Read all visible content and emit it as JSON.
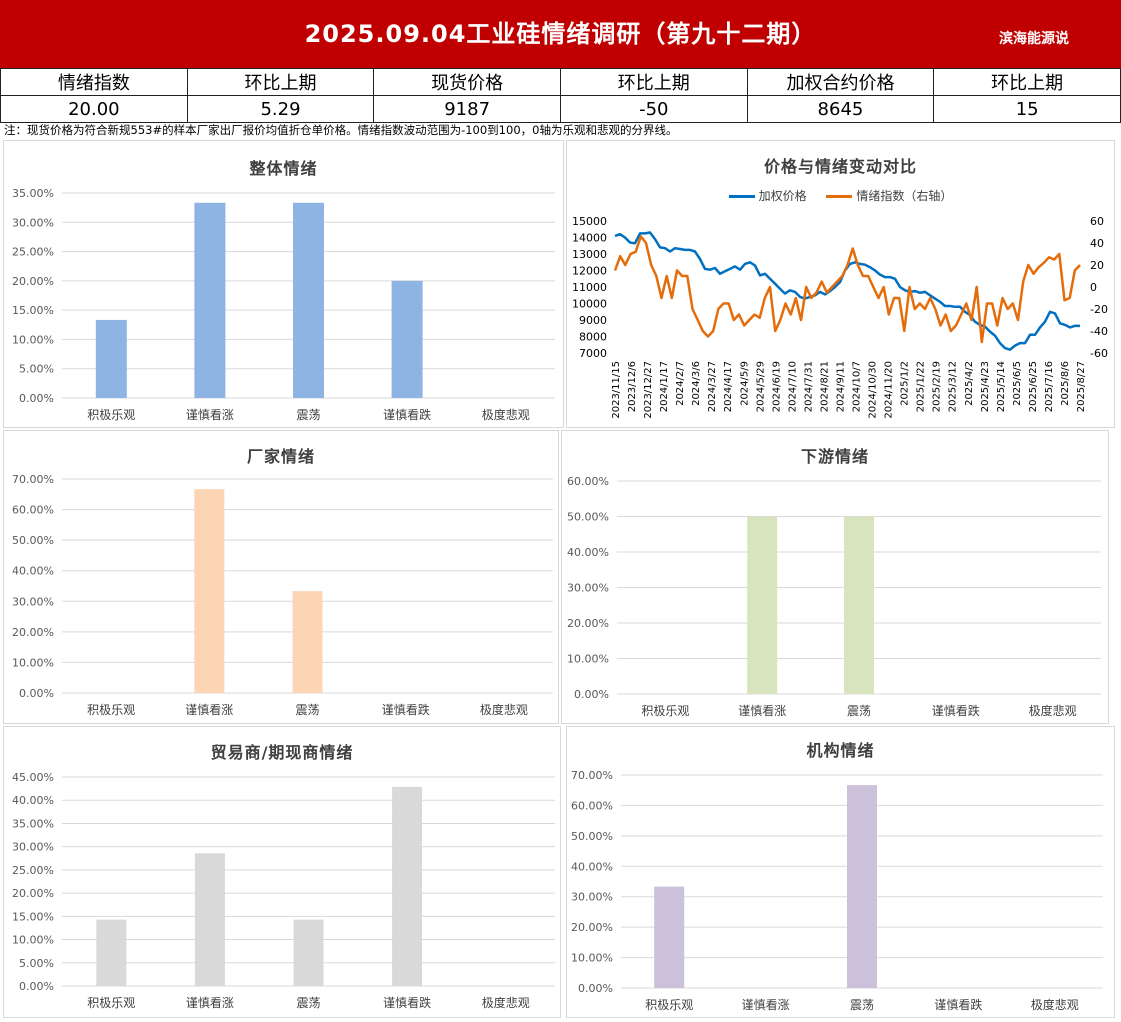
{
  "header": {
    "title": "2025.09.04工业硅情绪调研（第九十二期）",
    "brand": "滨海能源说"
  },
  "summary": {
    "labels": [
      "情绪指数",
      "环比上期",
      "现货价格",
      "环比上期",
      "加权合约价格",
      "环比上期"
    ],
    "values": [
      "20.00",
      "5.29",
      "9187",
      "-50",
      "8645",
      "15"
    ]
  },
  "note": "注：现货价格为符合新规553#的样本厂家出厂报价均值折仓单价格。情绪指数波动范围为-100到100，0轴为乐观和悲观的分界线。",
  "colors": {
    "header_bg": "#c00000",
    "overall": "#8eb4e3",
    "manufacturer": "#fcd5b5",
    "downstream": "#d7e4bd",
    "trader": "#d9d9d9",
    "institution": "#ccc1da",
    "price_line": "#0070c0",
    "sentiment_line": "#e46c0a"
  },
  "chart_data": [
    {
      "type": "bar",
      "title": "整体情绪",
      "categories": [
        "积极乐观",
        "谨慎看涨",
        "震荡",
        "谨慎看跌",
        "极度悲观"
      ],
      "values": [
        13.33,
        33.33,
        33.33,
        20.0,
        0
      ],
      "yticks": [
        "0.00%",
        "5.00%",
        "10.00%",
        "15.00%",
        "20.00%",
        "25.00%",
        "30.00%",
        "35.00%"
      ],
      "ylim": [
        0,
        35
      ],
      "grid": true
    },
    {
      "type": "line",
      "title": "价格与情绪变动对比",
      "legend": [
        "加权价格",
        "情绪指数（右轴）"
      ],
      "x_ticks": [
        "2023/11/15",
        "2023/12/6",
        "2023/12/27",
        "2024/1/17",
        "2024/2/7",
        "2024/3/6",
        "2024/3/27",
        "2024/4/17",
        "2024/5/9",
        "2024/5/29",
        "2024/6/19",
        "2024/7/10",
        "2024/7/31",
        "2024/8/21",
        "2024/9/11",
        "2024/10/7",
        "2024/10/30",
        "2024/11/20",
        "2025/1/2",
        "2025/1/22",
        "2025/2/19",
        "2025/3/12",
        "2025/4/2",
        "2025/4/23",
        "2025/5/14",
        "2025/6/5",
        "2025/6/25",
        "2025/7/16",
        "2025/8/6",
        "2025/8/27"
      ],
      "y_left_ticks": [
        "7000",
        "8000",
        "9000",
        "10000",
        "11000",
        "12000",
        "13000",
        "14000",
        "15000"
      ],
      "y_left_lim": [
        7000,
        15000
      ],
      "y_right_ticks": [
        "-60",
        "-40",
        "-20",
        "0",
        "20",
        "40",
        "60"
      ],
      "y_right_lim": [
        -60,
        60
      ],
      "series": [
        {
          "name": "加权价格",
          "axis": "left",
          "values": [
            14100,
            14200,
            14000,
            13700,
            13650,
            14250,
            14250,
            14300,
            13900,
            13400,
            13350,
            13150,
            13350,
            13300,
            13250,
            13250,
            13150,
            12700,
            12100,
            12050,
            12150,
            11800,
            11950,
            12100,
            12250,
            12050,
            12400,
            12500,
            12300,
            11700,
            11800,
            11500,
            11200,
            10900,
            10600,
            10800,
            10700,
            10400,
            10300,
            10400,
            10500,
            10700,
            10550,
            10750,
            11000,
            11300,
            12000,
            12400,
            12500,
            12400,
            12350,
            12200,
            12000,
            11750,
            11600,
            11600,
            11500,
            11000,
            10800,
            10700,
            10750,
            10650,
            10700,
            10500,
            10300,
            10100,
            9850,
            9850,
            9800,
            9800,
            9500,
            9300,
            8900,
            8700,
            8600,
            8300,
            8050,
            7600,
            7300,
            7200,
            7450,
            7600,
            7600,
            8100,
            8100,
            8550,
            8900,
            9500,
            9400,
            8800,
            8700,
            8550,
            8650,
            8645
          ]
        },
        {
          "name": "情绪指数（右轴）",
          "axis": "right",
          "values": [
            15,
            28,
            20,
            30,
            32,
            46,
            40,
            20,
            10,
            -10,
            10,
            -10,
            15,
            10,
            10,
            -20,
            -30,
            -40,
            -45,
            -40,
            -20,
            -15,
            -15,
            -30,
            -25,
            -35,
            -30,
            -25,
            -28,
            -10,
            0,
            -40,
            -30,
            -15,
            -25,
            -10,
            -30,
            0,
            -10,
            -5,
            5,
            -5,
            0,
            5,
            10,
            20,
            35,
            20,
            10,
            10,
            0,
            -10,
            0,
            -25,
            -10,
            -10,
            -40,
            0,
            -20,
            -15,
            -20,
            -10,
            -20,
            -35,
            -25,
            -40,
            -35,
            -25,
            -15,
            -30,
            0,
            -50,
            -15,
            -15,
            -35,
            -10,
            -20,
            -15,
            -30,
            5,
            20,
            12,
            18,
            22,
            27,
            25,
            30,
            -12,
            -10,
            15,
            20
          ]
        }
      ]
    },
    {
      "type": "bar",
      "title": "厂家情绪",
      "categories": [
        "积极乐观",
        "谨慎看涨",
        "震荡",
        "谨慎看跌",
        "极度悲观"
      ],
      "values": [
        0,
        66.67,
        33.33,
        0,
        0
      ],
      "yticks": [
        "0.00%",
        "10.00%",
        "20.00%",
        "30.00%",
        "40.00%",
        "50.00%",
        "60.00%",
        "70.00%"
      ],
      "ylim": [
        0,
        70
      ],
      "grid": true
    },
    {
      "type": "bar",
      "title": "下游情绪",
      "categories": [
        "积极乐观",
        "谨慎看涨",
        "震荡",
        "谨慎看跌",
        "极度悲观"
      ],
      "values": [
        0,
        50.0,
        50.0,
        0,
        0
      ],
      "yticks": [
        "0.00%",
        "10.00%",
        "20.00%",
        "30.00%",
        "40.00%",
        "50.00%",
        "60.00%"
      ],
      "ylim": [
        0,
        60
      ],
      "grid": true
    },
    {
      "type": "bar",
      "title": "贸易商/期现商情绪",
      "categories": [
        "积极乐观",
        "谨慎看涨",
        "震荡",
        "谨慎看跌",
        "极度悲观"
      ],
      "values": [
        14.29,
        28.57,
        14.29,
        42.86,
        0
      ],
      "yticks": [
        "0.00%",
        "5.00%",
        "10.00%",
        "15.00%",
        "20.00%",
        "25.00%",
        "30.00%",
        "35.00%",
        "40.00%",
        "45.00%"
      ],
      "ylim": [
        0,
        45
      ],
      "grid": true
    },
    {
      "type": "bar",
      "title": "机构情绪",
      "categories": [
        "积极乐观",
        "谨慎看涨",
        "震荡",
        "谨慎看跌",
        "极度悲观"
      ],
      "values": [
        33.33,
        0,
        66.67,
        0,
        0
      ],
      "yticks": [
        "0.00%",
        "10.00%",
        "20.00%",
        "30.00%",
        "40.00%",
        "50.00%",
        "60.00%",
        "70.00%"
      ],
      "ylim": [
        0,
        70
      ],
      "grid": true
    }
  ]
}
